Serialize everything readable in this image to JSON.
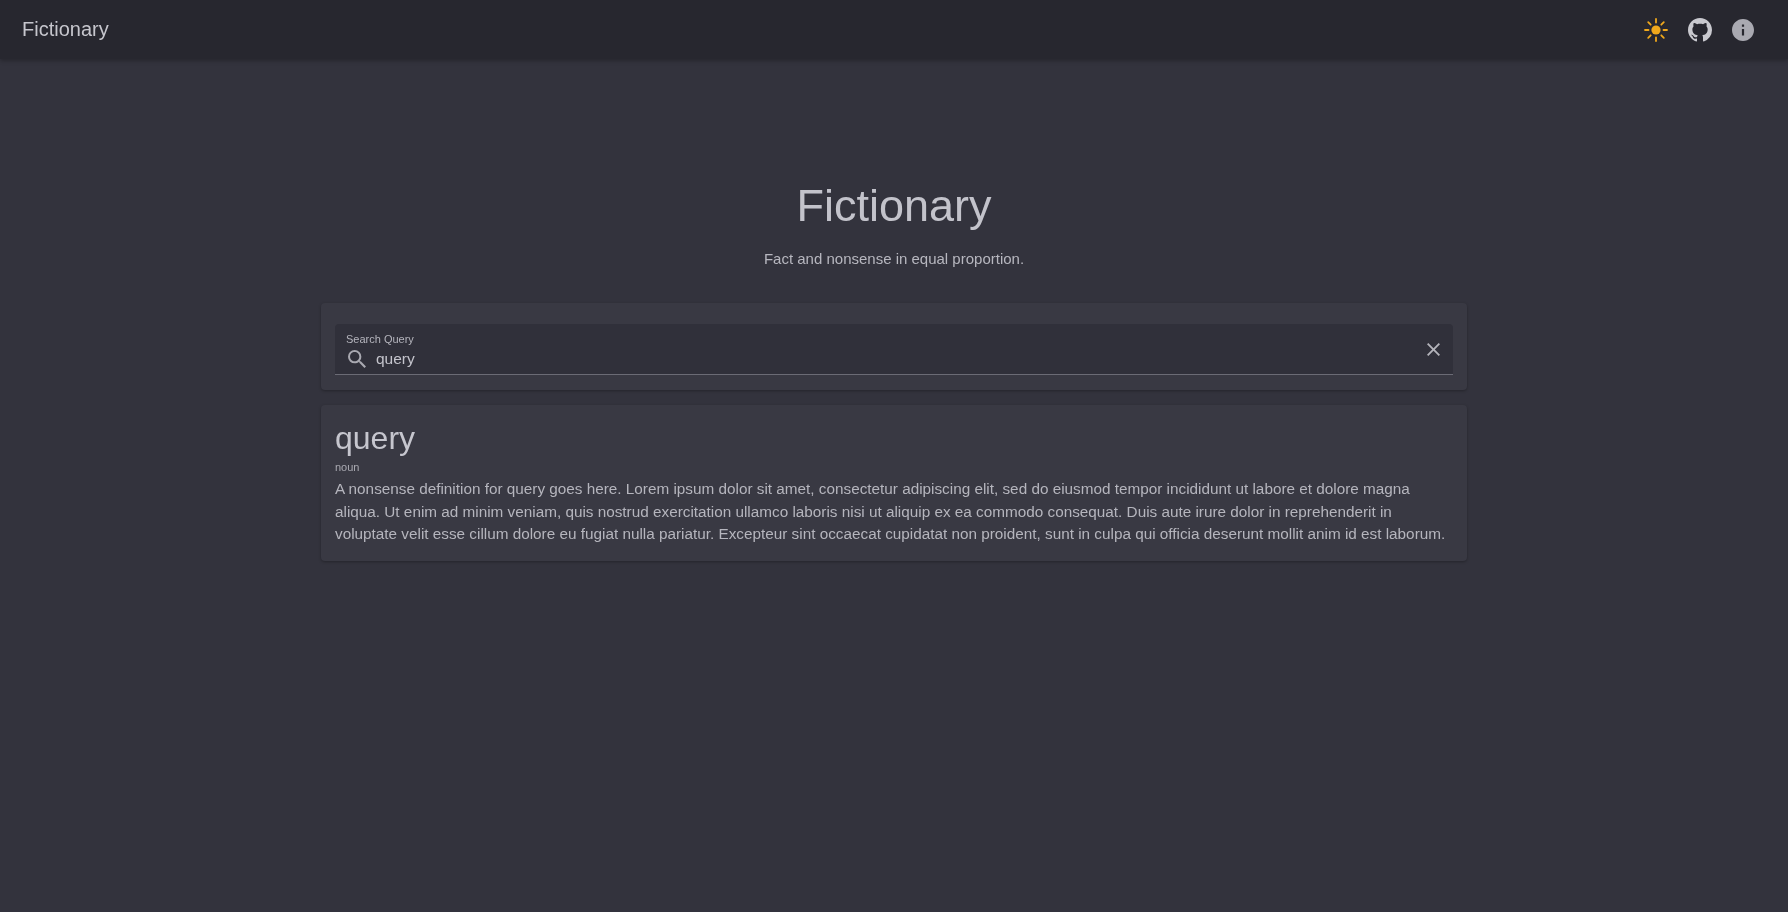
{
  "app_bar": {
    "title": "Fictionary"
  },
  "hero": {
    "title": "Fictionary",
    "tagline": "Fact and nonsense in equal proportion."
  },
  "search": {
    "label": "Search Query",
    "value": "query"
  },
  "results": [
    {
      "word": "query",
      "part_of_speech": "noun",
      "definition": "A nonsense definition for query goes here. Lorem ipsum dolor sit amet, consectetur adipiscing elit, sed do eiusmod tempor incididunt ut labore et dolore magna aliqua. Ut enim ad minim veniam, quis nostrud exercitation ullamco laboris nisi ut aliquip ex ea commodo consequat. Duis aute irure dolor in reprehenderit in voluptate velit esse cillum dolore eu fugiat nulla pariatur. Excepteur sint occaecat cupidatat non proident, sunt in culpa qui officia deserunt mollit anim id est laborum."
    }
  ]
}
